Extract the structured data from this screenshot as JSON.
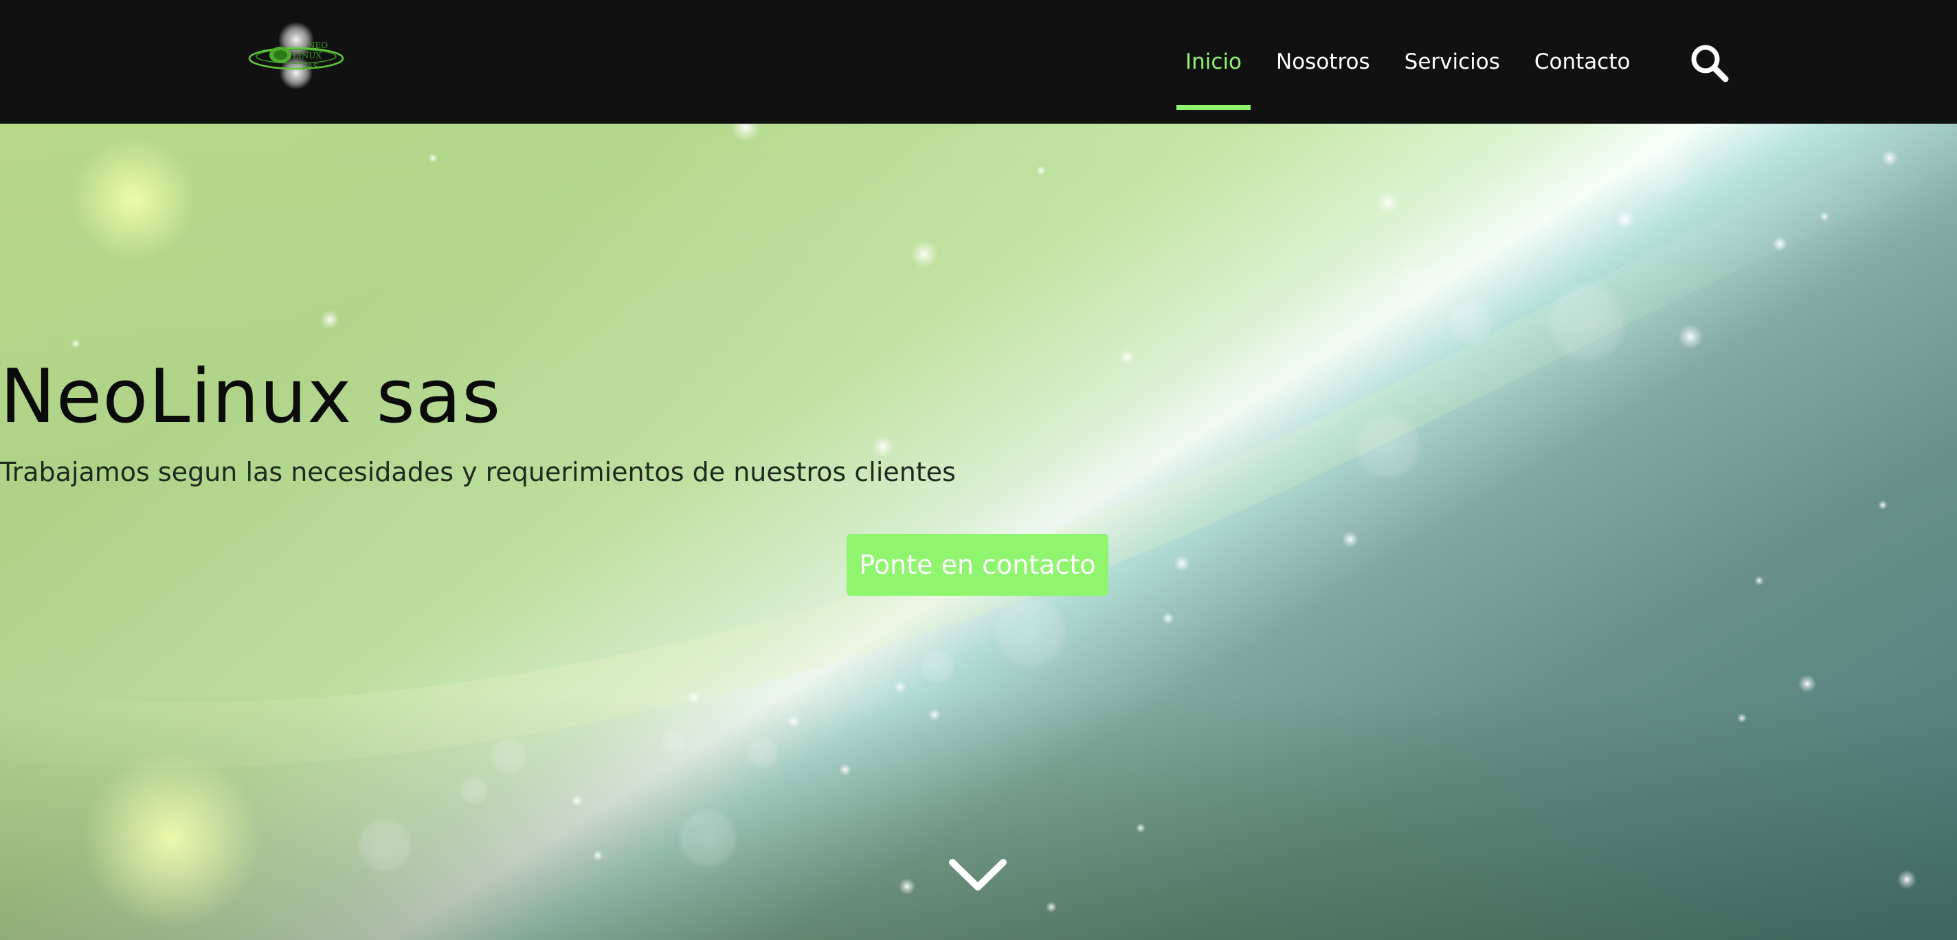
{
  "header": {
    "logo": {
      "line1": "NEO",
      "line2": "LINUX",
      "line3": "SAS",
      "icon": "neolinux-logo"
    },
    "nav": [
      {
        "label": "Inicio",
        "active": true
      },
      {
        "label": "Nosotros",
        "active": false
      },
      {
        "label": "Servicios",
        "active": false
      },
      {
        "label": "Contacto",
        "active": false
      }
    ],
    "search_icon": "search-icon"
  },
  "hero": {
    "title": "NeoLinux sas",
    "subtitle": "Trabajamos segun las necesidades y requerimientos de nuestros clientes",
    "cta_label": "Ponte en contacto",
    "scroll_icon": "chevron-down-icon"
  },
  "colors": {
    "header_bg": "#111111",
    "accent": "#8ff56e",
    "nav_text": "#ffffff",
    "title_text": "#0b0b0b"
  }
}
